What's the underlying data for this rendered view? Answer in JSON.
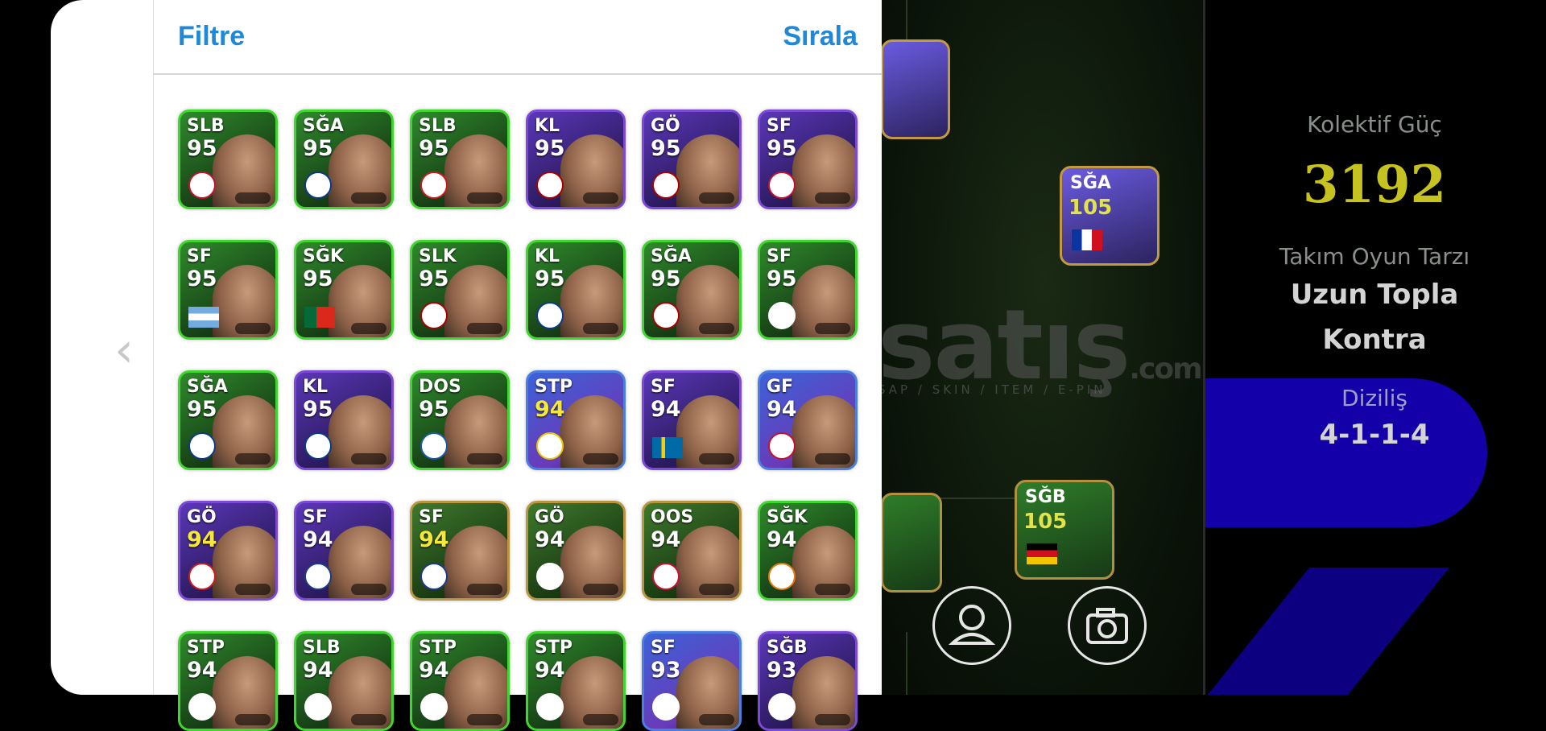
{
  "panel": {
    "filter_label": "Filtre",
    "sort_label": "Sırala",
    "back_icon": "chevron-left-icon"
  },
  "players": [
    {
      "pos": "SLB",
      "rating": "95",
      "frame": "green",
      "ovr_color": "#ffffff",
      "badge": "#c8102e"
    },
    {
      "pos": "SĞA",
      "rating": "95",
      "frame": "green",
      "ovr_color": "#ffffff",
      "badge": "#0a3a8a"
    },
    {
      "pos": "SLB",
      "rating": "95",
      "frame": "green",
      "ovr_color": "#ffffff",
      "badge": "#d01a1a"
    },
    {
      "pos": "KL",
      "rating": "95",
      "frame": "purple",
      "ovr_color": "#ffffff",
      "badge": "#a80000"
    },
    {
      "pos": "GÖ",
      "rating": "95",
      "frame": "purple",
      "ovr_color": "#ffffff",
      "badge": "#a80000"
    },
    {
      "pos": "SF",
      "rating": "95",
      "frame": "purple",
      "ovr_color": "#ffffff",
      "badge": "#c8102e"
    },
    {
      "pos": "SF",
      "rating": "95",
      "frame": "green",
      "ovr_color": "#ffffff",
      "flag": "argentina"
    },
    {
      "pos": "SĞK",
      "rating": "95",
      "frame": "green",
      "ovr_color": "#ffffff",
      "flag": "portugal"
    },
    {
      "pos": "SLK",
      "rating": "95",
      "frame": "green",
      "ovr_color": "#ffffff",
      "badge": "#a80000"
    },
    {
      "pos": "KL",
      "rating": "95",
      "frame": "green",
      "ovr_color": "#ffffff",
      "badge": "#0a3a8a"
    },
    {
      "pos": "SĞA",
      "rating": "95",
      "frame": "green",
      "ovr_color": "#ffffff",
      "badge": "#a80000"
    },
    {
      "pos": "SF",
      "rating": "95",
      "frame": "green",
      "ovr_color": "#ffffff",
      "badge": "#ffffff"
    },
    {
      "pos": "SĞA",
      "rating": "95",
      "frame": "green",
      "ovr_color": "#ffffff",
      "badge": "#0a3a8a"
    },
    {
      "pos": "KL",
      "rating": "95",
      "frame": "purple",
      "ovr_color": "#ffffff",
      "badge": "#0a3a8a"
    },
    {
      "pos": "DOS",
      "rating": "95",
      "frame": "green",
      "ovr_color": "#ffffff",
      "badge": "#1a5ba8"
    },
    {
      "pos": "STP",
      "rating": "94",
      "frame": "blue",
      "ovr_color": "#f5e83a",
      "badge": "#f2c500"
    },
    {
      "pos": "SF",
      "rating": "94",
      "frame": "purple",
      "ovr_color": "#ffffff",
      "flag": "sweden"
    },
    {
      "pos": "GF",
      "rating": "94",
      "frame": "blue",
      "ovr_color": "#ffffff",
      "badge": "#c8102e"
    },
    {
      "pos": "GÖ",
      "rating": "94",
      "frame": "purple",
      "ovr_color": "#f5e83a",
      "badge": "#d01a1a"
    },
    {
      "pos": "SF",
      "rating": "94",
      "frame": "purple",
      "ovr_color": "#ffffff",
      "badge": "#1a3a8a"
    },
    {
      "pos": "SF",
      "rating": "94",
      "frame": "gold",
      "ovr_color": "#f5e83a",
      "badge": "#1a3a8a"
    },
    {
      "pos": "GÖ",
      "rating": "94",
      "frame": "gold",
      "ovr_color": "#ffffff",
      "badge": "#ffffff"
    },
    {
      "pos": "OOS",
      "rating": "94",
      "frame": "gold",
      "ovr_color": "#ffffff",
      "badge": "#c8102e"
    },
    {
      "pos": "SĞK",
      "rating": "94",
      "frame": "green",
      "ovr_color": "#ffffff",
      "badge": "#e87a0a"
    },
    {
      "pos": "STP",
      "rating": "94",
      "frame": "green",
      "ovr_color": "#ffffff",
      "badge": "#ffffff"
    },
    {
      "pos": "SLB",
      "rating": "94",
      "frame": "green",
      "ovr_color": "#ffffff",
      "badge": "#ffffff"
    },
    {
      "pos": "STP",
      "rating": "94",
      "frame": "green",
      "ovr_color": "#ffffff",
      "badge": "#ffffff"
    },
    {
      "pos": "STP",
      "rating": "94",
      "frame": "green",
      "ovr_color": "#ffffff",
      "badge": "#ffffff"
    },
    {
      "pos": "SF",
      "rating": "93",
      "frame": "blue",
      "ovr_color": "#ffffff",
      "badge": "#ffffff"
    },
    {
      "pos": "SĞB",
      "rating": "93",
      "frame": "purple",
      "ovr_color": "#ffffff",
      "badge": "#ffffff"
    }
  ],
  "pitch_cards": [
    {
      "pos": "SĞA",
      "rating": "105",
      "flag": "france"
    },
    {
      "pos": "SĞB",
      "rating": "105",
      "flag": "germany"
    }
  ],
  "team": {
    "power_label": "Kolektif Güç",
    "power_value": "3192",
    "style_label": "Takım Oyun Tarzı",
    "style_value_line1": "Uzun Topla",
    "style_value_line2": "Kontra",
    "formation_label": "Diziliş",
    "formation_value": "4-1-1-4"
  },
  "watermark": {
    "main": "satış",
    "suffix": ".com",
    "sub": "SAP / SKIN / ITEM / E-PIN"
  },
  "buttons": {
    "profile_icon": "user-icon",
    "camera_icon": "camera-icon"
  },
  "colors": {
    "accent_blue": "#1e88d9",
    "power_yellow": "#c6c21f",
    "frame_green": "#3fd62d",
    "frame_purple": "#7b49d6"
  }
}
